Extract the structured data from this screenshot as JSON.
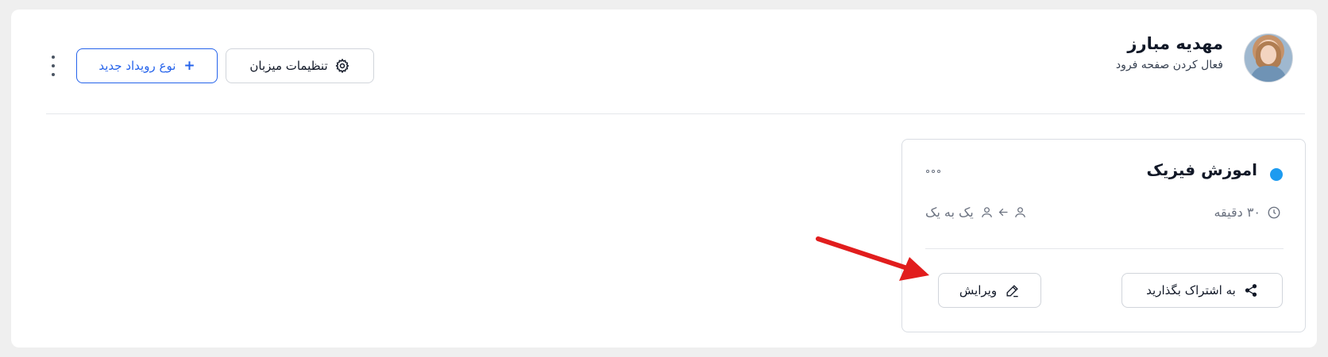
{
  "profile": {
    "name": "مهدیه مبارز",
    "subtitle": "فعال کردن صفحه فرود"
  },
  "header": {
    "new_event_type_label": "نوع رویداد جدید",
    "new_event_plus": "+",
    "host_settings_label": "تنظیمات میزبان"
  },
  "event_card": {
    "title": "اموزش فیزیک",
    "duration": "۳۰ دقیقه",
    "meeting_type": "یک به یک",
    "share_label": "به اشتراک بگذارید",
    "edit_label": "ویرایش",
    "dot_color": "#1d9bf0"
  },
  "colors": {
    "accent": "#2563eb",
    "annotation_arrow": "#e11d1d"
  },
  "icons": {
    "header": [
      "more-vertical-icon",
      "gear-icon",
      "plus-icon"
    ],
    "card": [
      "more-horizontal-icon",
      "clock-icon",
      "user-icon",
      "arrow-icon",
      "share-icon",
      "pencil-icon"
    ]
  }
}
